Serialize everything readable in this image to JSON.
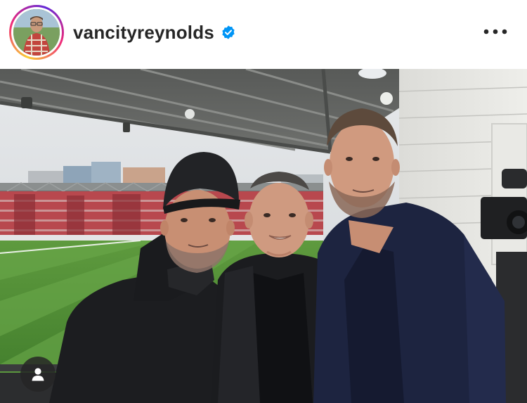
{
  "post": {
    "username": "vancityreynolds",
    "verified": true,
    "avatar_icon": "profile-photo-icon",
    "verified_icon": "verified-badge-icon",
    "more_icon": "more-options-icon",
    "tag_icon": "tagged-people-icon"
  },
  "colors": {
    "username": "#262626",
    "verified_badge": "#0095f6",
    "header_bg": "#ffffff",
    "story_ring_start": "#f9ce34",
    "story_ring_end": "#6228d7"
  }
}
